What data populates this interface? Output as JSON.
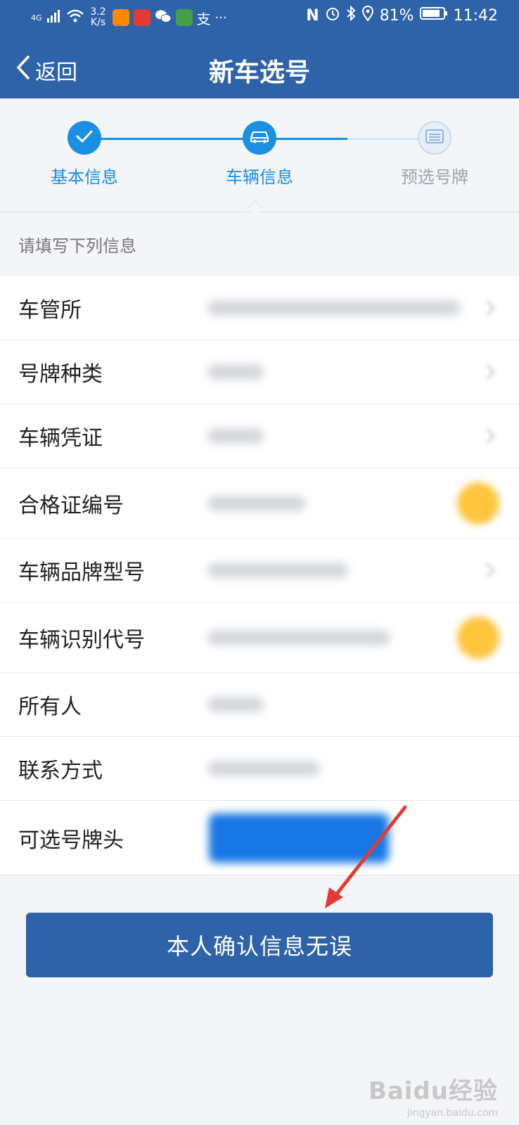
{
  "status_bar": {
    "network": "4G",
    "speed_value": "3.2",
    "speed_unit": "K/s",
    "battery": "81%",
    "time": "11:42"
  },
  "nav": {
    "back_label": "返回",
    "title": "新车选号"
  },
  "steps": [
    {
      "label": "基本信息",
      "state": "done"
    },
    {
      "label": "车辆信息",
      "state": "active"
    },
    {
      "label": "预选号牌",
      "state": "pending"
    }
  ],
  "section_hint": "请填写下列信息",
  "form": {
    "rows": [
      {
        "label": "车管所"
      },
      {
        "label": "号牌种类"
      },
      {
        "label": "车辆凭证"
      },
      {
        "label": "合格证编号"
      },
      {
        "label": "车辆品牌型号"
      },
      {
        "label": "车辆识别代号"
      },
      {
        "label": "所有人"
      },
      {
        "label": "联系方式"
      },
      {
        "label": "可选号牌头"
      }
    ]
  },
  "confirm_button": "本人确认信息无误",
  "watermark": {
    "main": "Baidu经验",
    "sub": "jingyan.baidu.com"
  },
  "colors": {
    "brand": "#2e63a9",
    "step_active": "#1a8fe3",
    "step_pending": "#c5dcf2",
    "warning": "#ffc53d",
    "annotation_arrow": "#e53935"
  }
}
